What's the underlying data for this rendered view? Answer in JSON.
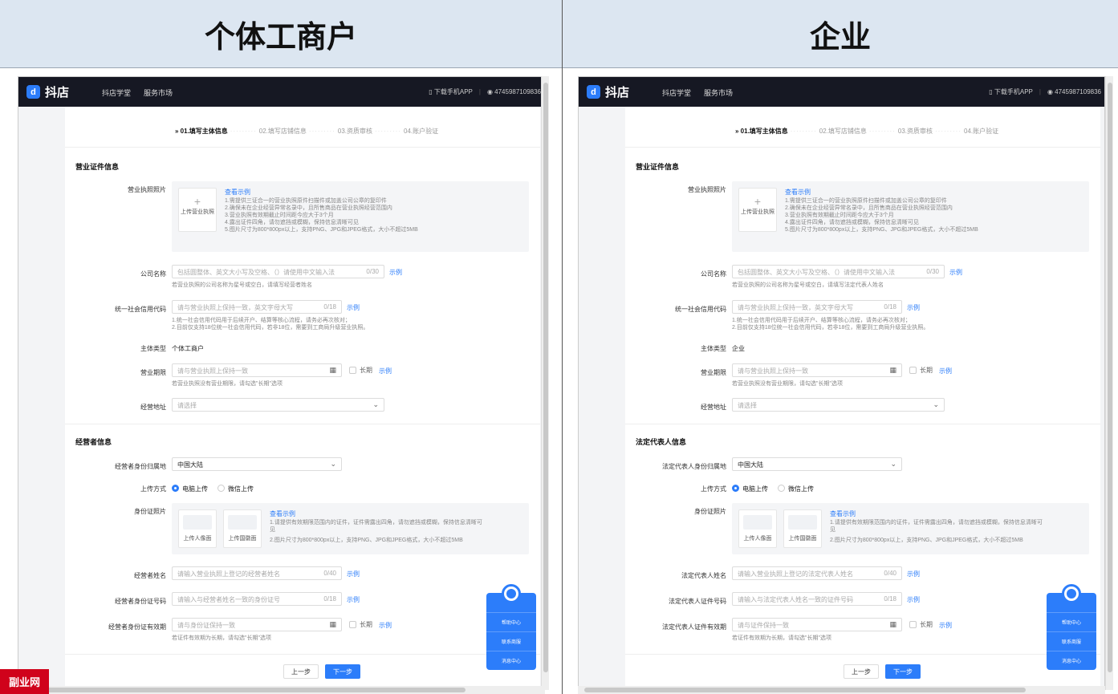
{
  "headers": {
    "left": "个体工商户",
    "right": "企业"
  },
  "topbar": {
    "logo": "抖店",
    "nav": [
      "抖店学堂",
      "服务市场"
    ],
    "download": "下载手机APP",
    "account": "4745987109836"
  },
  "steps": [
    "» 01.填写主体信息",
    "02.填写店铺信息",
    "03.资质审核",
    "04.账户验证"
  ],
  "license": {
    "section": "营业证件信息",
    "photo_label": "营业执照照片",
    "upload_text": "上传营业执照",
    "example": "查看示例",
    "rules": [
      "1.需提供三证合一的营业执照原件扫描件或加盖公司公章的复印件",
      "2.确保未在企业经营异常名录中，且所售商品在营业执照经营范围内",
      "3.营业执照有效期截止时间距今应大于3个月",
      "4.露出证件四角，请勿遮挡或模糊，保持信息清晰可见",
      "5.图片尺寸为800*800px以上，支持PNG、JPG和JPEG格式，大小不超过5MB"
    ],
    "company_label": "公司名称",
    "company_ph": "包括圆整体、英文大小写及空格、（）请使用中文输入法",
    "company_cnt": "0/30",
    "example_short": "示例",
    "company_hint_left": "若营业执照的公司名称为星号或空白，请填写经营者姓名",
    "company_hint_right": "若营业执照的公司名称为星号或空白，请填写法定代表人姓名",
    "credit_label": "统一社会信用代码",
    "credit_ph": "请与营业执照上保持一致，英文字母大写",
    "credit_cnt": "0/18",
    "credit_hint1": "1.统一社会信用代码用于后续开户、结算等核心流程，请务必再次核对；",
    "credit_hint2": "2.目前仅支持18位统一社会信用代码，若非18位，需要到工商局升级营业执照。",
    "type_label": "主体类型",
    "type_left": "个体工商户",
    "type_right": "企业",
    "term_label": "营业期限",
    "term_ph": "请与营业执照上保持一致",
    "long": "长期",
    "term_hint": "若营业执照没有营业期限，请勾选\"长期\"选项",
    "addr_label": "经营地址",
    "addr_ph": "请选择"
  },
  "person": {
    "section_left": "经营者信息",
    "section_right": "法定代表人信息",
    "region_label_left": "经营者身份归属地",
    "region_label_right": "法定代表人身份归属地",
    "region_value": "中国大陆",
    "method_label": "上传方式",
    "method_pc": "电脑上传",
    "method_wx": "微信上传",
    "idphoto_label": "身份证照片",
    "id_front": "上传人像面",
    "id_back": "上传国徽面",
    "id_example": "查看示例",
    "id_rule1": "1.请提供有效期限范围内的证件，证件需露出四角，请勿遮挡或模糊，保持信息清晰可见",
    "id_rule2": "2.图片尺寸为800*800px以上，支持PNG、JPG和JPEG格式，大小不超过5MB",
    "name_label_left": "经营者姓名",
    "name_label_right": "法定代表人姓名",
    "name_ph_left": "请输入营业执照上登记的经营者姓名",
    "name_ph_right": "请输入营业执照上登记的法定代表人姓名",
    "name_cnt": "0/40",
    "idno_label_left": "经营者身份证号码",
    "idno_label_right": "法定代表人证件号码",
    "idno_ph_left": "请输入与经营者姓名一致的身份证号",
    "idno_ph_right": "请输入与法定代表人姓名一致的证件号码",
    "idno_cnt": "0/18",
    "valid_label_left": "经营者身份证有效期",
    "valid_label_right": "法定代表人证件有效期",
    "valid_ph": "请与身份证保持一致",
    "valid_ph_right": "请与证件保持一致",
    "valid_hint": "若证件有效期为长期，请勾选\"长期\"选项"
  },
  "buttons": {
    "prev": "上一步",
    "next": "下一步"
  },
  "help": {
    "center": "帮助中心",
    "service": "联系商服",
    "msg": "消息中心"
  },
  "watermark": "副业网",
  "colors": {
    "accent": "#2c7dfa",
    "topbar": "#161823",
    "header_bg": "#dce6f1"
  }
}
